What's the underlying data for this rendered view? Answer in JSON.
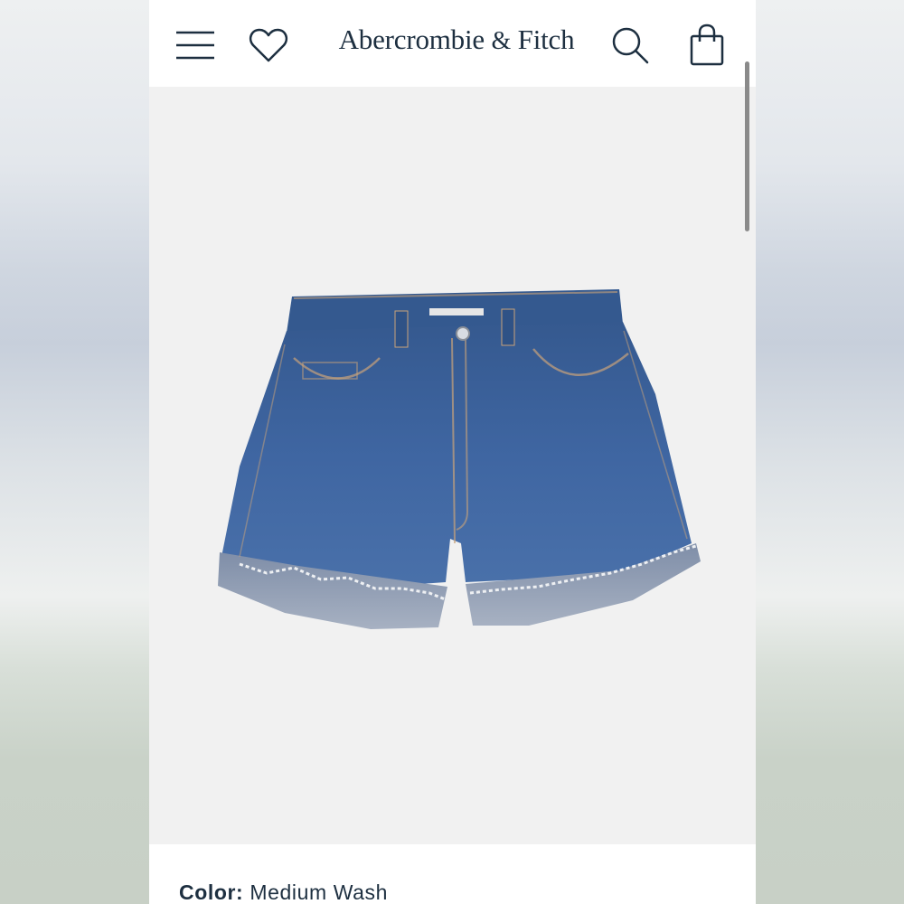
{
  "header": {
    "brand_main": "Abercrombie",
    "brand_amp": "&",
    "brand_tail": "Fitch",
    "icons": [
      "menu-icon",
      "heart-icon",
      "search-icon",
      "shopping-bag-icon"
    ]
  },
  "product": {
    "image_subject": "denim-shorts-image"
  },
  "details": {
    "color_label": "Color:",
    "color_value": "Medium Wash"
  },
  "colors": {
    "brand": "#1d2f40",
    "denim": "#3e64a0",
    "background": "#f1f1f1"
  }
}
